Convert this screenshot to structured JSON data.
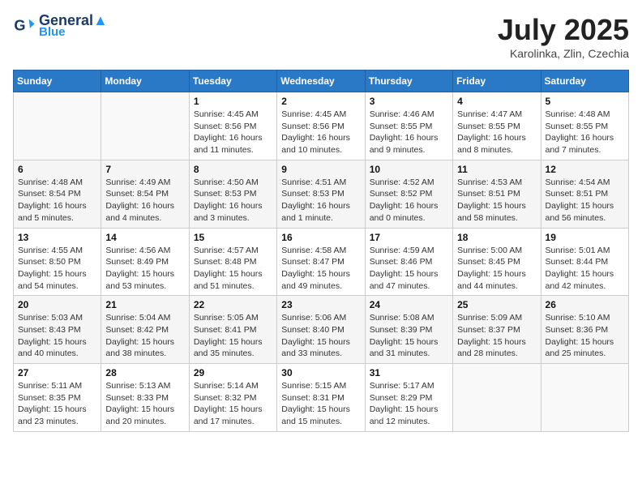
{
  "header": {
    "logo_line1": "General",
    "logo_line2": "Blue",
    "month_year": "July 2025",
    "location": "Karolinka, Zlin, Czechia"
  },
  "days_of_week": [
    "Sunday",
    "Monday",
    "Tuesday",
    "Wednesday",
    "Thursday",
    "Friday",
    "Saturday"
  ],
  "weeks": [
    [
      {
        "day": "",
        "info": ""
      },
      {
        "day": "",
        "info": ""
      },
      {
        "day": "1",
        "info": "Sunrise: 4:45 AM\nSunset: 8:56 PM\nDaylight: 16 hours and 11 minutes."
      },
      {
        "day": "2",
        "info": "Sunrise: 4:45 AM\nSunset: 8:56 PM\nDaylight: 16 hours and 10 minutes."
      },
      {
        "day": "3",
        "info": "Sunrise: 4:46 AM\nSunset: 8:55 PM\nDaylight: 16 hours and 9 minutes."
      },
      {
        "day": "4",
        "info": "Sunrise: 4:47 AM\nSunset: 8:55 PM\nDaylight: 16 hours and 8 minutes."
      },
      {
        "day": "5",
        "info": "Sunrise: 4:48 AM\nSunset: 8:55 PM\nDaylight: 16 hours and 7 minutes."
      }
    ],
    [
      {
        "day": "6",
        "info": "Sunrise: 4:48 AM\nSunset: 8:54 PM\nDaylight: 16 hours and 5 minutes."
      },
      {
        "day": "7",
        "info": "Sunrise: 4:49 AM\nSunset: 8:54 PM\nDaylight: 16 hours and 4 minutes."
      },
      {
        "day": "8",
        "info": "Sunrise: 4:50 AM\nSunset: 8:53 PM\nDaylight: 16 hours and 3 minutes."
      },
      {
        "day": "9",
        "info": "Sunrise: 4:51 AM\nSunset: 8:53 PM\nDaylight: 16 hours and 1 minute."
      },
      {
        "day": "10",
        "info": "Sunrise: 4:52 AM\nSunset: 8:52 PM\nDaylight: 16 hours and 0 minutes."
      },
      {
        "day": "11",
        "info": "Sunrise: 4:53 AM\nSunset: 8:51 PM\nDaylight: 15 hours and 58 minutes."
      },
      {
        "day": "12",
        "info": "Sunrise: 4:54 AM\nSunset: 8:51 PM\nDaylight: 15 hours and 56 minutes."
      }
    ],
    [
      {
        "day": "13",
        "info": "Sunrise: 4:55 AM\nSunset: 8:50 PM\nDaylight: 15 hours and 54 minutes."
      },
      {
        "day": "14",
        "info": "Sunrise: 4:56 AM\nSunset: 8:49 PM\nDaylight: 15 hours and 53 minutes."
      },
      {
        "day": "15",
        "info": "Sunrise: 4:57 AM\nSunset: 8:48 PM\nDaylight: 15 hours and 51 minutes."
      },
      {
        "day": "16",
        "info": "Sunrise: 4:58 AM\nSunset: 8:47 PM\nDaylight: 15 hours and 49 minutes."
      },
      {
        "day": "17",
        "info": "Sunrise: 4:59 AM\nSunset: 8:46 PM\nDaylight: 15 hours and 47 minutes."
      },
      {
        "day": "18",
        "info": "Sunrise: 5:00 AM\nSunset: 8:45 PM\nDaylight: 15 hours and 44 minutes."
      },
      {
        "day": "19",
        "info": "Sunrise: 5:01 AM\nSunset: 8:44 PM\nDaylight: 15 hours and 42 minutes."
      }
    ],
    [
      {
        "day": "20",
        "info": "Sunrise: 5:03 AM\nSunset: 8:43 PM\nDaylight: 15 hours and 40 minutes."
      },
      {
        "day": "21",
        "info": "Sunrise: 5:04 AM\nSunset: 8:42 PM\nDaylight: 15 hours and 38 minutes."
      },
      {
        "day": "22",
        "info": "Sunrise: 5:05 AM\nSunset: 8:41 PM\nDaylight: 15 hours and 35 minutes."
      },
      {
        "day": "23",
        "info": "Sunrise: 5:06 AM\nSunset: 8:40 PM\nDaylight: 15 hours and 33 minutes."
      },
      {
        "day": "24",
        "info": "Sunrise: 5:08 AM\nSunset: 8:39 PM\nDaylight: 15 hours and 31 minutes."
      },
      {
        "day": "25",
        "info": "Sunrise: 5:09 AM\nSunset: 8:37 PM\nDaylight: 15 hours and 28 minutes."
      },
      {
        "day": "26",
        "info": "Sunrise: 5:10 AM\nSunset: 8:36 PM\nDaylight: 15 hours and 25 minutes."
      }
    ],
    [
      {
        "day": "27",
        "info": "Sunrise: 5:11 AM\nSunset: 8:35 PM\nDaylight: 15 hours and 23 minutes."
      },
      {
        "day": "28",
        "info": "Sunrise: 5:13 AM\nSunset: 8:33 PM\nDaylight: 15 hours and 20 minutes."
      },
      {
        "day": "29",
        "info": "Sunrise: 5:14 AM\nSunset: 8:32 PM\nDaylight: 15 hours and 17 minutes."
      },
      {
        "day": "30",
        "info": "Sunrise: 5:15 AM\nSunset: 8:31 PM\nDaylight: 15 hours and 15 minutes."
      },
      {
        "day": "31",
        "info": "Sunrise: 5:17 AM\nSunset: 8:29 PM\nDaylight: 15 hours and 12 minutes."
      },
      {
        "day": "",
        "info": ""
      },
      {
        "day": "",
        "info": ""
      }
    ]
  ]
}
